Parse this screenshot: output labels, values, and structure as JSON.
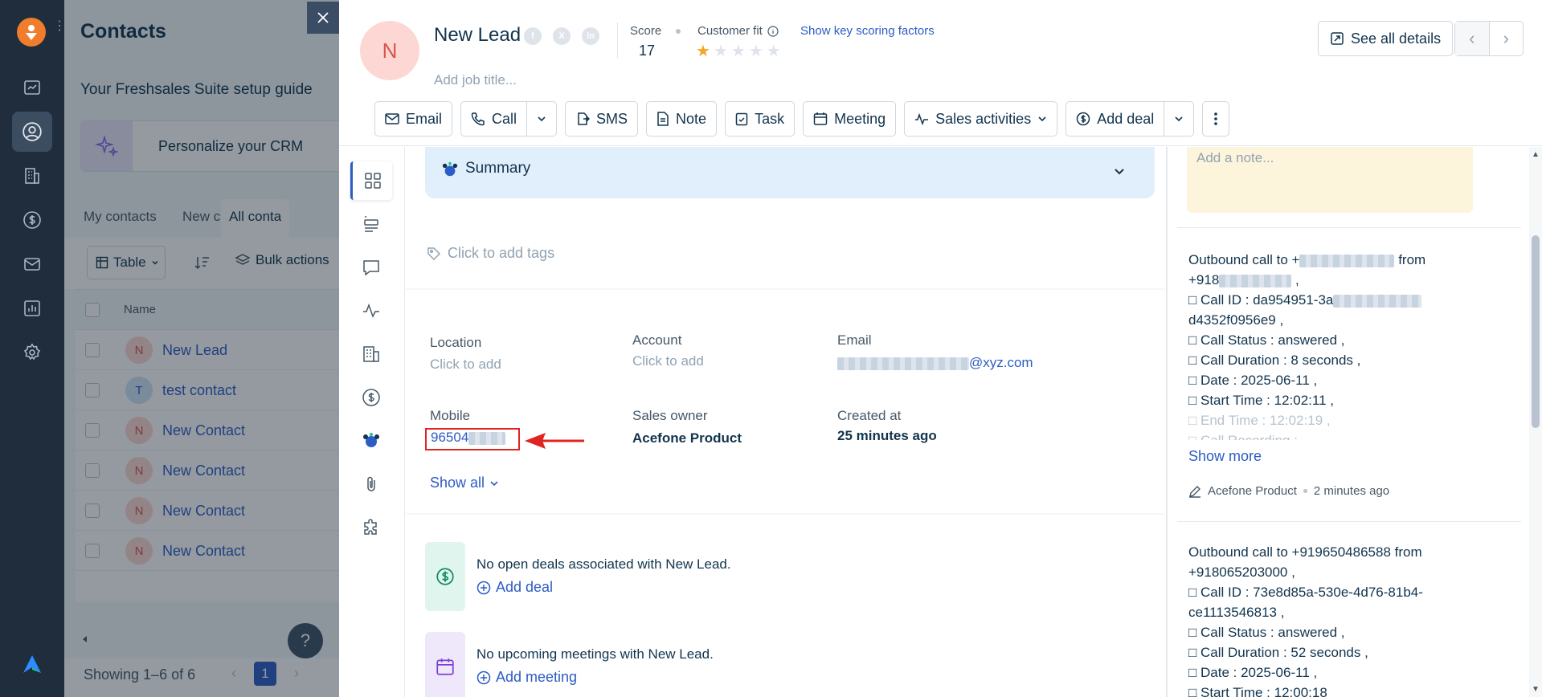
{
  "contacts_page": {
    "title": "Contacts",
    "guide_title": "Your Freshsales Suite setup guide",
    "guide_card_label": "Personalize your CRM",
    "tabs": [
      "My contacts",
      "New contacts",
      "All conta"
    ],
    "table_button": "Table",
    "bulk_actions": "Bulk actions",
    "column_name": "Name",
    "rows": [
      {
        "initial": "N",
        "name": "New Lead",
        "color": "#fdd7d3"
      },
      {
        "initial": "T",
        "name": "test contact",
        "color": "#cfe3f7"
      },
      {
        "initial": "N",
        "name": "New Contact",
        "color": "#fdd7d3"
      },
      {
        "initial": "N",
        "name": "New Contact",
        "color": "#fdd7d3"
      },
      {
        "initial": "N",
        "name": "New Contact",
        "color": "#fdd7d3"
      },
      {
        "initial": "N",
        "name": "New Contact",
        "color": "#fdd7d3"
      }
    ],
    "showing": "Showing 1–6 of 6",
    "current_page": "1",
    "help": "?"
  },
  "header": {
    "avatar_initial": "N",
    "name": "New Lead",
    "score_label": "Score",
    "score_value": "17",
    "fit_label": "Customer fit",
    "fit_rating": 1,
    "fit_max": 5,
    "key_factors_link": "Show key scoring factors",
    "job_title_placeholder": "Add job title...",
    "see_all_details": "See all details"
  },
  "actions": {
    "email": "Email",
    "call": "Call",
    "sms": "SMS",
    "note": "Note",
    "task": "Task",
    "meeting": "Meeting",
    "sales_activities": "Sales activities",
    "add_deal": "Add deal"
  },
  "details": {
    "summary_label": "Summary",
    "tags_placeholder": "Click to add tags",
    "location_label": "Location",
    "location_value": "Click to add",
    "account_label": "Account",
    "account_value": "Click to add",
    "email_label": "Email",
    "email_suffix": "@xyz.com",
    "mobile_label": "Mobile",
    "mobile_value": "96504",
    "sales_owner_label": "Sales owner",
    "sales_owner_value": "Acefone Product",
    "created_label": "Created at",
    "created_value": "25 minutes ago",
    "show_all": "Show all",
    "deals_empty": "No open deals associated with New Lead.",
    "add_deal": "Add deal",
    "meetings_empty": "No upcoming meetings with New Lead.",
    "add_meeting": "Add meeting"
  },
  "notes": {
    "add_note_placeholder": "Add a note...",
    "activity1": {
      "line1_prefix": "Outbound call to +",
      "line1_suffix": "from",
      "line2": "+918",
      "call_id_prefix": "□ Call ID : da954951-3a",
      "call_id_end": "d4352f0956e9 ,",
      "status": "□ Call Status : answered ,",
      "duration": "□ Call Duration : 8 seconds ,",
      "date": "□ Date : 2025-06-11 ,",
      "start": "□ Start Time : 12:02:11 ,",
      "end": "□ End Time : 12:02:19 ,",
      "recording": "□ Call Recording : ...",
      "show_more": "Show more",
      "author": "Acefone Product",
      "time": "2 minutes ago"
    },
    "activity2": {
      "line1": "Outbound call to +919650486588 from",
      "line2": "+918065203000 ,",
      "call_id": "□ Call ID : 73e8d85a-530e-4d76-81b4-",
      "call_id_end": "ce1113546813 ,",
      "status": "□ Call Status : answered ,",
      "duration": "□ Call Duration : 52 seconds ,",
      "date": "□ Date : 2025-06-11 ,",
      "start": "□ Start Time : 12:00:18"
    }
  }
}
